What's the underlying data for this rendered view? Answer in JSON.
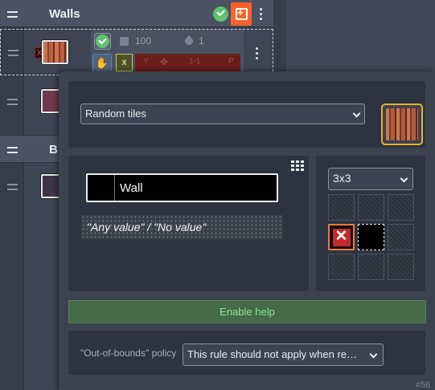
{
  "background": {
    "group1": {
      "title": "Walls",
      "icons": [
        "drag-handle-icon",
        "check-circle-icon",
        "add-rule-icon",
        "more-icon"
      ],
      "accent": "#fb6227"
    },
    "rule1": {
      "chance": "100",
      "drop_count": "1",
      "x_label": "X",
      "strip_labels": [
        "Y",
        "1-1",
        "P"
      ],
      "x_mark": "X"
    },
    "group2": {
      "title": "B"
    }
  },
  "popup": {
    "mode_select": {
      "value": "Random tiles",
      "options": [
        "Random tiles"
      ]
    },
    "value_field": {
      "name": "Wall"
    },
    "any_value_label": "\"Any value\" / \"No value\"",
    "pattern": {
      "size_select": "3x3",
      "cells": [
        "empty",
        "empty",
        "empty",
        "not",
        "center",
        "empty",
        "empty",
        "empty",
        "empty"
      ],
      "x_glyph": "✕"
    },
    "help_button": "Enable help",
    "oob": {
      "label": "\"Out-of-bounds\" policy",
      "value": "This rule should not apply when re…"
    },
    "footer_id": "#56"
  },
  "colors": {
    "accent_orange": "#fb6227",
    "preview_border": "#e8b02c",
    "help_green": "#8fe598",
    "not_red": "#c42a2a"
  }
}
